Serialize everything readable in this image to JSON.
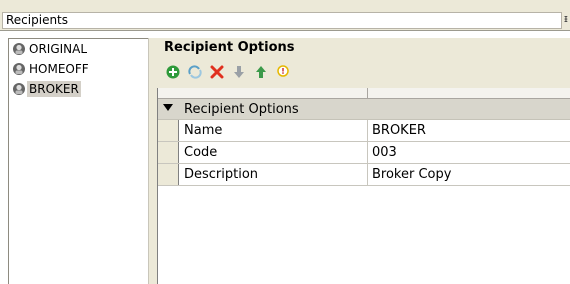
{
  "panel": {
    "title": "Recipients"
  },
  "recipients": [
    {
      "label": "ORIGINAL",
      "selected": false
    },
    {
      "label": "HOMEOFF",
      "selected": false
    },
    {
      "label": "BROKER",
      "selected": true
    }
  ],
  "options": {
    "section_title": "Recipient Options",
    "toolbar": [
      {
        "name": "add-icon",
        "color": "#2e9a3a"
      },
      {
        "name": "refresh-icon",
        "color": "#5aa0c8"
      },
      {
        "name": "delete-icon",
        "color": "#e0301e"
      },
      {
        "name": "move-down-icon",
        "color": "#9aa0a6"
      },
      {
        "name": "move-up-icon",
        "color": "#3c9a4a"
      },
      {
        "name": "info-icon",
        "color": "#e6b800"
      }
    ],
    "group_label": "Recipient Options",
    "properties": [
      {
        "name": "Name",
        "value": "BROKER"
      },
      {
        "name": "Code",
        "value": "003"
      },
      {
        "name": "Description",
        "value": "Broker Copy"
      }
    ]
  }
}
